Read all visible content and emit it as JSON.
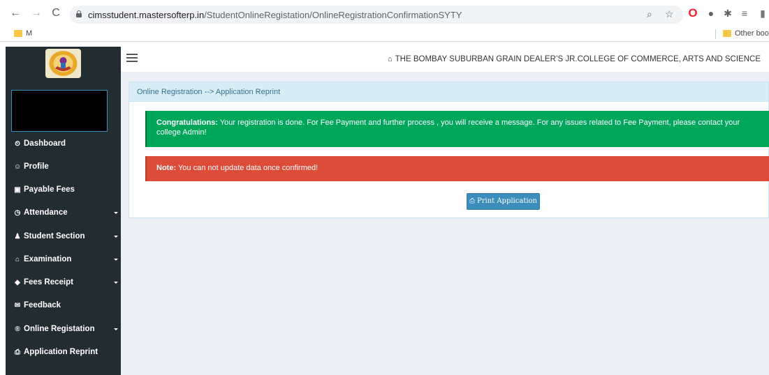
{
  "browser": {
    "url_host": "cimsstudent.mastersofterp.in",
    "url_path": "/StudentOnlineRegistation/OnlineRegistrationConfirmationSYTY",
    "bookmarks": [
      {
        "label": "M"
      },
      {
        "label": "Other boo"
      }
    ]
  },
  "header": {
    "college_name": "THE BOMBAY SUBURBAN GRAIN DEALER’S JR.COLLEGE OF COMMERCE, ARTS AND SCIENCE"
  },
  "sidebar": {
    "items": [
      {
        "label": "Dashboard",
        "icon": "dashboard-icon",
        "glyph": "⏲",
        "submenu": false
      },
      {
        "label": "Profile",
        "icon": "user-circle-icon",
        "glyph": "☺",
        "submenu": false
      },
      {
        "label": "Payable Fees",
        "icon": "money-icon",
        "glyph": "▣",
        "submenu": false
      },
      {
        "label": "Attendance",
        "icon": "clock-icon",
        "glyph": "◷",
        "submenu": true
      },
      {
        "label": "Student Section",
        "icon": "user-icon",
        "glyph": "♟",
        "submenu": true
      },
      {
        "label": "Examination",
        "icon": "institution-icon",
        "glyph": "⌂",
        "submenu": true
      },
      {
        "label": "Fees Receipt",
        "icon": "tag-icon",
        "glyph": "◆",
        "submenu": true
      },
      {
        "label": "Feedback",
        "icon": "comments-icon",
        "glyph": "✉",
        "submenu": false
      },
      {
        "label": "Online Registation",
        "icon": "registered-icon",
        "glyph": "®",
        "submenu": true
      },
      {
        "label": "Application Reprint",
        "icon": "print-icon",
        "glyph": "⎙",
        "submenu": false
      }
    ]
  },
  "main": {
    "breadcrumb": "Online Registration --> Application Reprint",
    "success_strong": "Congratulations:",
    "success_text": " Your registration is done. For Fee Payment and further process , you will receive a message. For any issues related to Fee Payment, please contact your college Admin!",
    "note_strong": "Note:",
    "note_text": " You can not update data once confirmed!",
    "print_button": "Print Application"
  },
  "colors": {
    "sidebar_bg": "#222d32",
    "success": "#00a65a",
    "danger": "#dd4b39",
    "primary": "#3c8dbc",
    "box_header": "#d9edf7"
  }
}
